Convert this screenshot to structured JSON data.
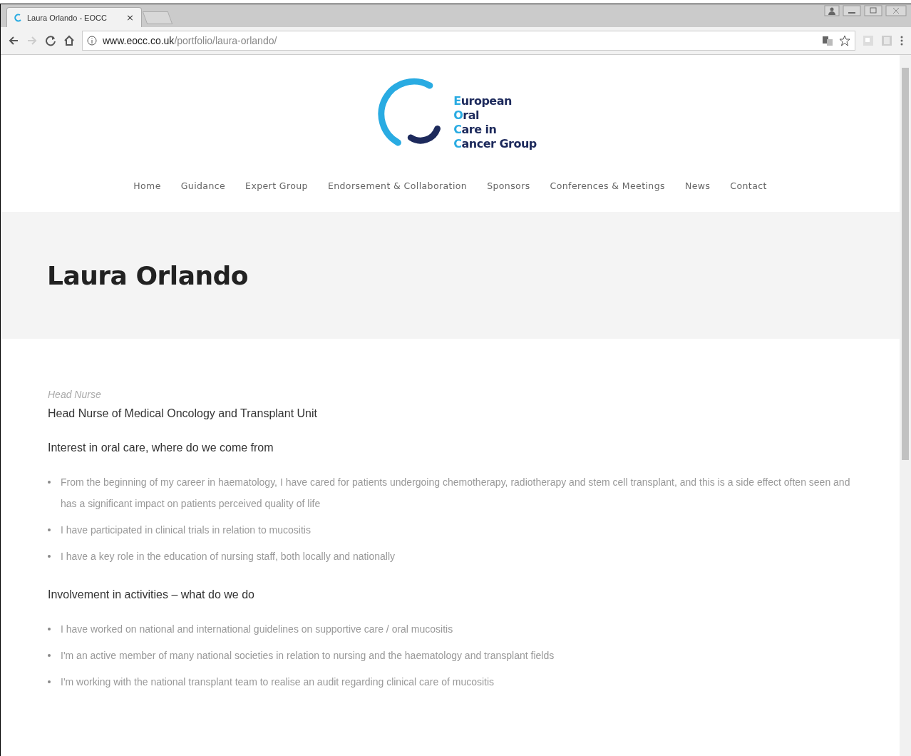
{
  "browser": {
    "tab_title": "Laura Orlando - EOCC",
    "tab_close": "×",
    "url_host": "www.eocc.co.uk",
    "url_path": "/portfolio/laura-orlando/"
  },
  "logo": {
    "lines": [
      "European",
      "Oral",
      "Care in",
      "Cancer Group"
    ]
  },
  "nav": [
    "Home",
    "Guidance",
    "Expert Group",
    "Endorsement & Collaboration",
    "Sponsors",
    "Conferences & Meetings",
    "News",
    "Contact"
  ],
  "page_title": "Laura Orlando",
  "subtitle": "Head Nurse",
  "role": "Head Nurse of Medical Oncology and Transplant Unit",
  "sections": [
    {
      "heading": "Interest in oral care, where do we come from",
      "items": [
        "From the beginning of my career in haematology, I have cared for patients undergoing chemotherapy, radiotherapy and stem cell transplant, and this is a side effect often seen and has a significant impact on patients perceived quality of life",
        "I have participated in clinical trials in relation to mucositis",
        "I have a key role in the education of nursing staff, both locally and nationally"
      ]
    },
    {
      "heading": "Involvement in activities – what do we do",
      "items": [
        "I have worked on national and international guidelines on supportive care / oral mucositis",
        "I'm an active member of many national societies in relation to nursing and the haematology and transplant fields",
        "I'm working with the national transplant team to realise an audit regarding clinical care of mucositis"
      ]
    }
  ]
}
